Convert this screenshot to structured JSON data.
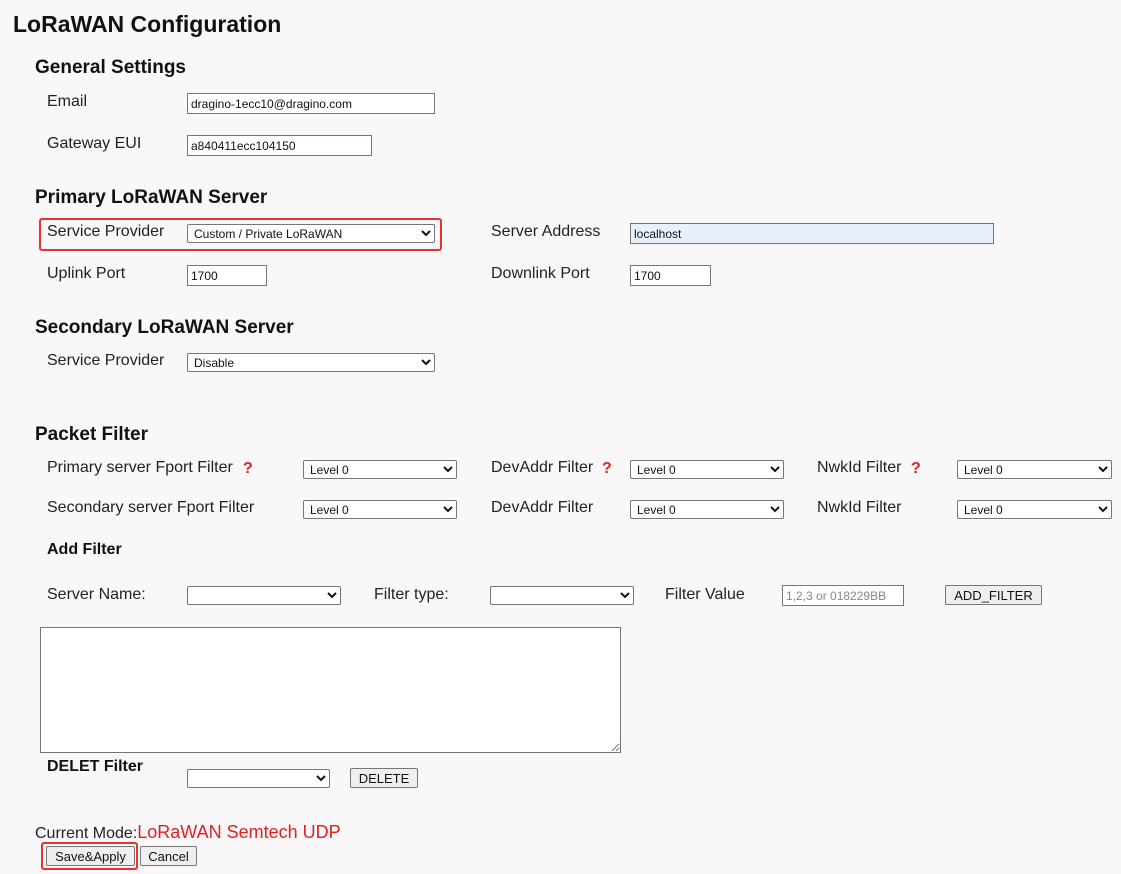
{
  "page_title": "LoRaWAN Configuration",
  "general": {
    "title": "General Settings",
    "email_label": "Email",
    "email_value": "dragino-1ecc10@dragino.com",
    "gateway_eui_label": "Gateway EUI",
    "gateway_eui_value": "a840411ecc104150"
  },
  "primary": {
    "title": "Primary LoRaWAN Server",
    "service_provider_label": "Service Provider",
    "service_provider_value": "Custom / Private LoRaWAN",
    "server_address_label": "Server Address",
    "server_address_value": "localhost",
    "uplink_port_label": "Uplink Port",
    "uplink_port_value": "1700",
    "downlink_port_label": "Downlink Port",
    "downlink_port_value": "1700"
  },
  "secondary": {
    "title": "Secondary LoRaWAN Server",
    "service_provider_label": "Service Provider",
    "service_provider_value": "Disable"
  },
  "packet_filter": {
    "title": "Packet Filter",
    "primary_fport_label": "Primary server Fport Filter",
    "primary_fport_value": "Level 0",
    "primary_devaddr_label": "DevAddr Filter",
    "primary_devaddr_value": "Level 0",
    "primary_nwkid_label": "NwkId Filter",
    "primary_nwkid_value": "Level 0",
    "secondary_fport_label": "Secondary server Fport Filter",
    "secondary_fport_value": "Level 0",
    "secondary_devaddr_label": "DevAddr Filter",
    "secondary_devaddr_value": "Level 0",
    "secondary_nwkid_label": "NwkId Filter",
    "secondary_nwkid_value": "Level 0",
    "help_symbol": "?"
  },
  "add_filter": {
    "title": "Add Filter",
    "server_name_label": "Server Name:",
    "server_name_value": "",
    "filter_type_label": "Filter type:",
    "filter_type_value": "",
    "filter_value_label": "Filter Value",
    "filter_value_placeholder": "1,2,3 or 018229BB",
    "add_button": "ADD_FILTER"
  },
  "delete_filter": {
    "title": "DELET Filter",
    "value": "",
    "delete_button": "DELETE"
  },
  "status": {
    "current_mode_label": "Current Mode:",
    "current_mode_value": "LoRaWAN Semtech UDP"
  },
  "actions": {
    "save_apply": "Save&Apply",
    "cancel": "Cancel"
  },
  "colors": {
    "highlight_box": "#e8342e",
    "mode_text": "#e01f1f",
    "help_icon": "#e02020"
  }
}
